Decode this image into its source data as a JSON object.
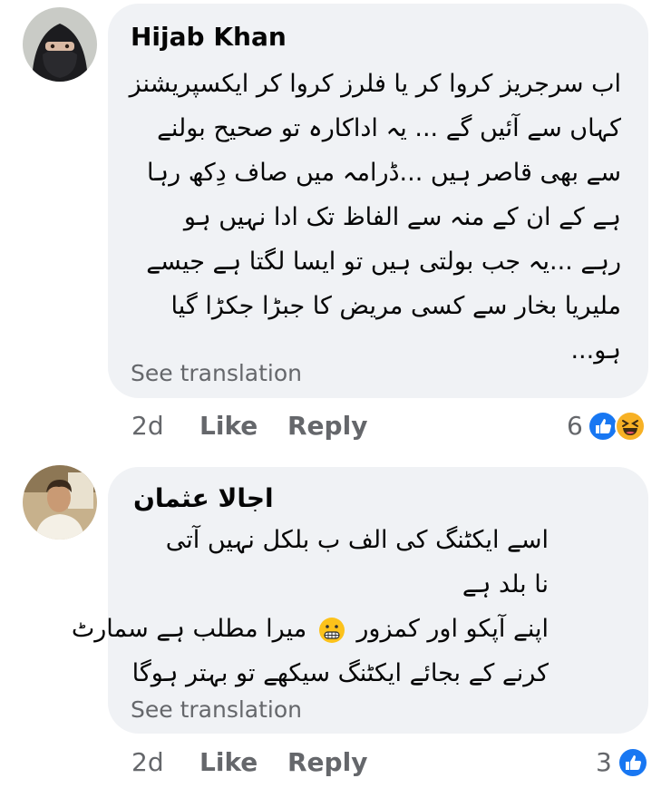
{
  "comments": [
    {
      "author": "Hijab Khan",
      "lines": [
        "اب سرجریز کروا کر یا فلرز کروا کر ایکسپریشنز",
        "کہاں سے آئیں گے ... یہ اداکارہ تو صحیح بولنے",
        "سے بھی قاصر ہیں ...ڈرامہ میں صاف دِکھ رہا",
        "ہے کے ان کے منہ سے الفاظ تک ادا نہیں ہو",
        "رہے ...یہ جب بولتی ہیں تو ایسا لگتا ہے جیسے",
        "ملیریا بخار سے کسی مریض کا جبڑا جکڑا گیا",
        "ہو..."
      ],
      "see_translation": "See translation",
      "time": "2d",
      "like": "Like",
      "reply": "Reply",
      "reaction_count": "6",
      "reactions": [
        "like-icon",
        "haha-icon"
      ]
    },
    {
      "author": "اجالا عثمان",
      "lines": [
        "اسے ایکٹنگ کی الف ب بلکل نہیں آتی",
        "نا بلد ہے",
        "اپنے آپکو اور کمزور",
        "میرا مطلب ہے سمارٹ",
        "کرنے کے بجائے ایکٹنگ سیکھے تو بہتر ہوگا"
      ],
      "inline_emoji": "grimacing-emoji",
      "see_translation": "See translation",
      "time": "2d",
      "like": "Like",
      "reply": "Reply",
      "reaction_count": "3",
      "reactions": [
        "like-icon"
      ]
    }
  ],
  "colors": {
    "bubble": "#f0f2f5",
    "secondary_text": "#65676b",
    "like_blue": "#1877f2",
    "haha_yellow": "#f7b125"
  }
}
